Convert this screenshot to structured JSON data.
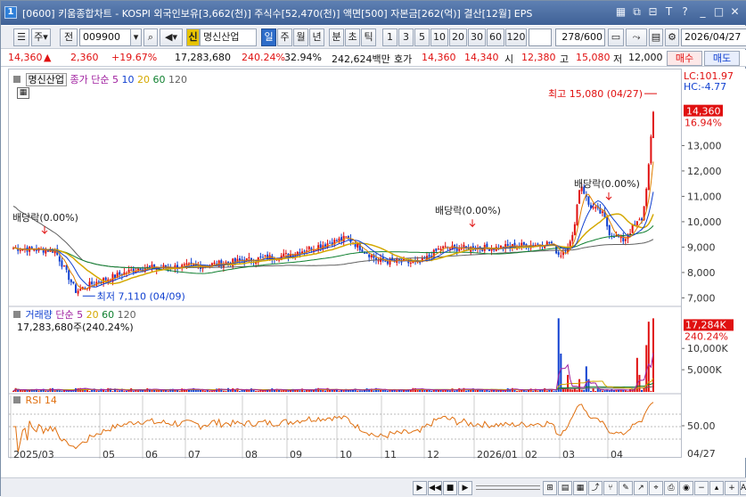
{
  "window": {
    "number": "1",
    "title": "[0600] 키움종합차트 - KOSPI 외국인보유[3,662(천)] 주식수[52,470(천)] 액면[500] 자본금[262(억)] 결산[12월] EPS"
  },
  "toolbar": {
    "type_label": "주",
    "period_label": "전",
    "code": "009900",
    "credit_badge": "신",
    "stock_name": "명신산업",
    "periods": [
      "일",
      "주",
      "월",
      "년",
      "분",
      "초",
      "틱"
    ],
    "minutes": [
      "1",
      "3",
      "5",
      "10",
      "20",
      "30",
      "60",
      "120"
    ],
    "count": "278",
    "count_total": "/600",
    "date": "2026/04/27"
  },
  "quote": {
    "price": "14,360",
    "arrow": "▲",
    "change": "2,360",
    "change_pct": "+19.67%",
    "volume": "17,283,680",
    "volume_ratio": "240.24%",
    "turnover": "32.94%",
    "amount": "242,624백만",
    "hoga_label": "호가",
    "ask": "14,360",
    "bid": "14,340",
    "open_label": "시",
    "open": "12,380",
    "high_label": "고",
    "high": "15,080",
    "low_label": "저",
    "low": "12,000",
    "buy_label": "매수",
    "sell_label": "매도"
  },
  "price_panel": {
    "stock_label": "명신산업",
    "ma_label": "종가 단순",
    "ma_periods": [
      "5",
      "10",
      "20",
      "60",
      "120"
    ],
    "lc": "LC:101.97",
    "hc": "HC:-4.77",
    "current_price_tag": "14,360",
    "current_pct_tag": "16.94%",
    "max_label": "최고 15,080 (04/27)",
    "min_label": "최저 7,110 (04/09)",
    "dividend_labels": [
      "배당락(0.00%)",
      "배당락(0.00%)",
      "배당락(0.00%)"
    ],
    "y_ticks": [
      "13,000",
      "12,000",
      "11,000",
      "10,000",
      "9,000",
      "8,000",
      "7,000"
    ]
  },
  "volume_panel": {
    "label": "거래량",
    "ma_label": "단순",
    "ma_periods": [
      "5",
      "20",
      "60",
      "120"
    ],
    "value_text": "17,283,680주(240.24%)",
    "current_tag": "17,284K",
    "current_pct_tag": "240.24%",
    "y_ticks": [
      "10,000K",
      "5,000K"
    ]
  },
  "rsi_panel": {
    "label": "RSI 14",
    "y_ticks": [
      "50.00"
    ]
  },
  "x_axis": {
    "labels": [
      "2025/03",
      "05",
      "06",
      "07",
      "08",
      "09",
      "10",
      "11",
      "12",
      "2026/01",
      "02",
      "03",
      "04"
    ],
    "last_date": "04/27"
  },
  "colors": {
    "up": "#e01010",
    "down": "#1040d0",
    "ma5": "#e08000",
    "ma10": "#1040d0",
    "ma20": "#d4a800",
    "ma60": "#108030",
    "ma120": "#606060",
    "rsi": "#e07010"
  }
}
